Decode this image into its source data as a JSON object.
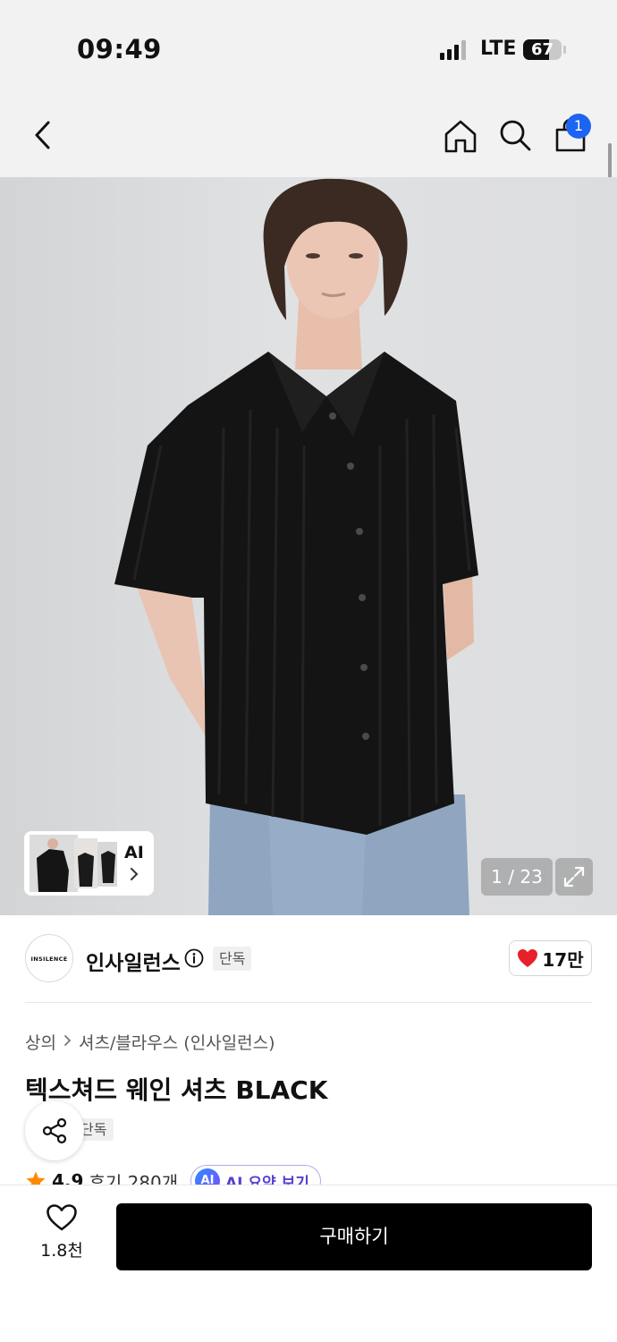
{
  "status_bar": {
    "time": "09:49",
    "network": "LTE",
    "battery": "67",
    "battery_level": 0.67
  },
  "nav": {
    "back_icon": "chevron-left-icon",
    "home_icon": "home-icon",
    "search_icon": "search-icon",
    "cart_icon": "shopping-bag-icon",
    "cart_badge": "1"
  },
  "gallery": {
    "ai_label": "AI",
    "counter": "1 / 23",
    "expand_icon": "expand-icon"
  },
  "brand": {
    "logo_text": "INSILENCE",
    "name": "인사일런스",
    "exclusive_tag": "단독",
    "likes": "17만"
  },
  "product": {
    "breadcrumb": [
      "상의",
      "셔츠/블라우스 (인사일런스)"
    ],
    "title": "텍스쳐드 웨인 셔츠 BLACK",
    "tag": "단독",
    "rating": "4.9",
    "reviews": "후기 280개",
    "ai_summary": "AI 요약 보기",
    "ai_badge": "AI"
  },
  "bottom": {
    "wish_count": "1.8천",
    "buy_label": "구매하기"
  },
  "colors": {
    "accent_blue": "#1c64f2",
    "like_red": "#e8202a",
    "star_orange": "#ff8a00",
    "ai_purple": "#5b3fd0"
  }
}
